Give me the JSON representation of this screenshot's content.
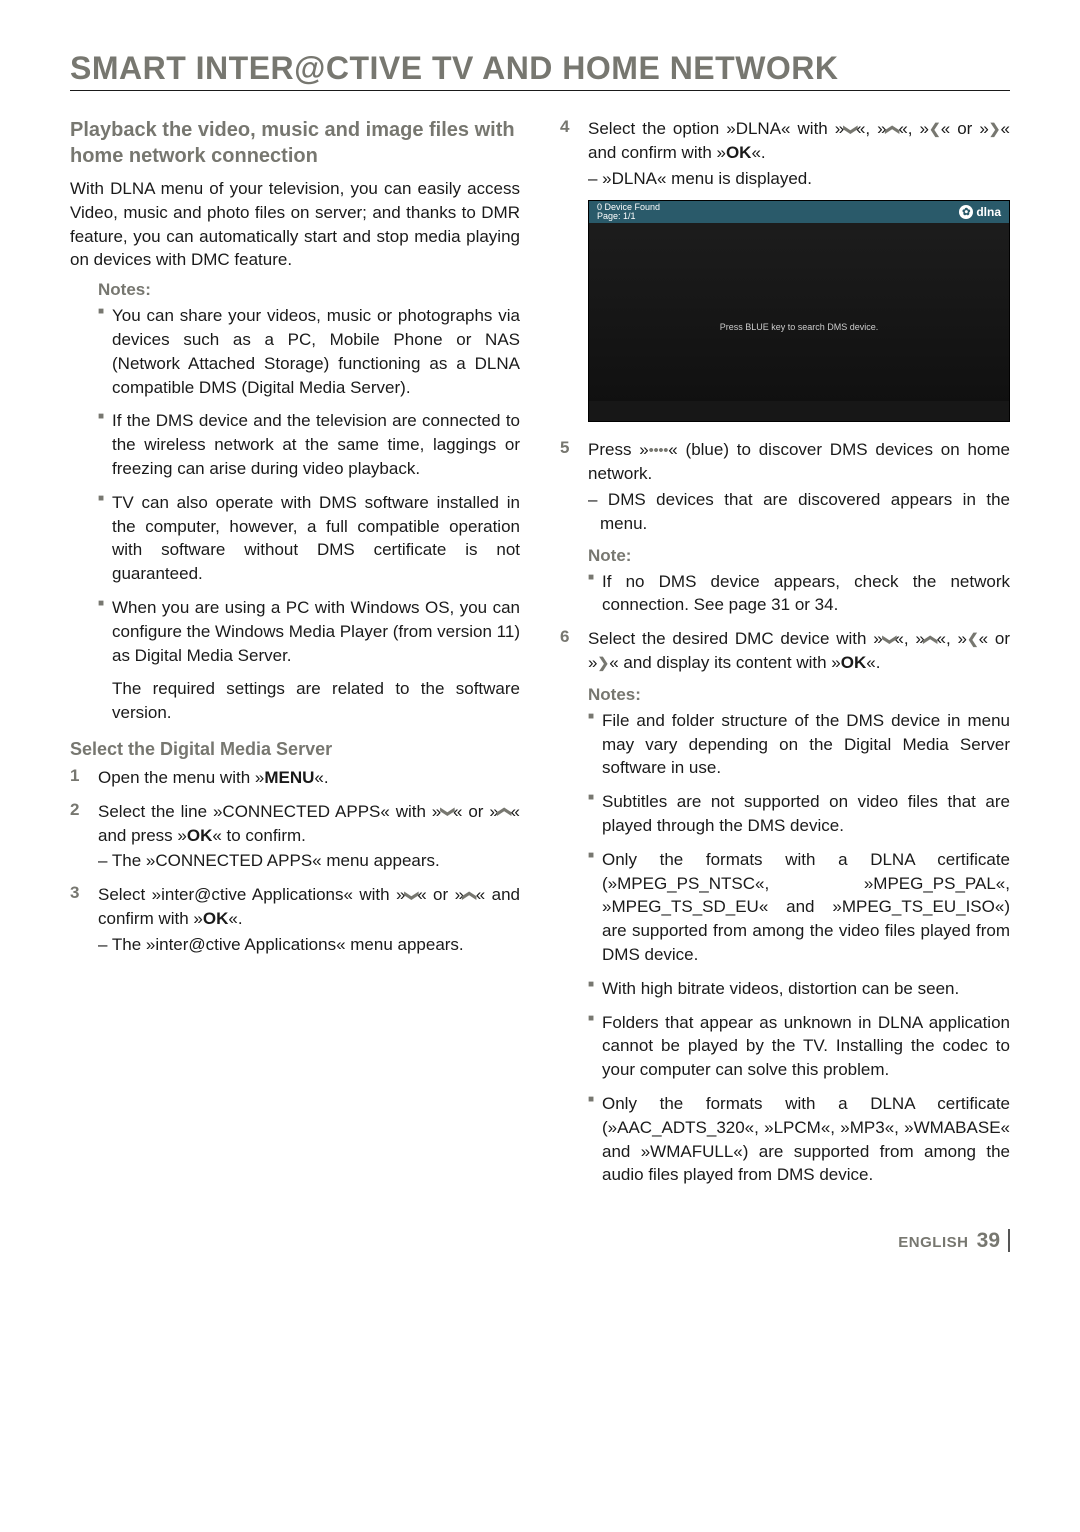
{
  "title": "SMART INTER@CTIVE TV AND HOME NETWORK",
  "left": {
    "heading": "Playback the video, music and image files with home network connection",
    "intro": "With DLNA menu of your television, you can easily access Video, music and photo files on server; and thanks to DMR feature, you can automatically start and stop media playing on devices with DMC feature.",
    "notes_label": "Notes:",
    "notes": [
      "You can share your videos, music or photographs via devices such as a PC, Mobile Phone or NAS (Network Attached Storage) functioning as a DLNA compatible DMS (Digital Media Server).",
      "If the DMS device and the television are connected to the wireless network at the same time, laggings or freezing can arise during video playback.",
      "TV can also operate with DMS software installed in the computer, however, a full compatible operation with software without DMS certificate is not guaranteed.",
      "When you are using a PC with Windows OS, you can configure the Windows Media Player (from version 11) as Digital Media Server.",
      "The required settings are related to the software version."
    ],
    "sub_heading": "Select the Digital Media Server",
    "steps": {
      "s1": {
        "n": "1",
        "pre": "Open the menu with »",
        "key": "MENU",
        "post": "«."
      },
      "s2": {
        "n": "2",
        "text_a": "Select the line »CONNECTED APPS« with »",
        "text_b": "« or »",
        "text_c": "« and press »",
        "key": "OK",
        "text_d": "« to confirm.",
        "sub": "– The »CONNECTED APPS« menu appears."
      },
      "s3": {
        "n": "3",
        "text_a": "Select »inter@ctive Applications« with »",
        "text_b": "« or »",
        "text_c": "« and confirm with »",
        "key": "OK",
        "text_d": "«.",
        "sub": "– The »inter@ctive Applications« menu appears."
      }
    }
  },
  "right": {
    "step4": {
      "n": "4",
      "text_a": "Select the option »DLNA« with »",
      "text_b": "«, »",
      "text_c": "«, »",
      "text_d": "« or »",
      "text_e": "« and confirm with »",
      "key": "OK",
      "text_f": "«.",
      "sub": "– »DLNA« menu is displayed."
    },
    "screenshot": {
      "device_found": "0   Device Found",
      "page": "Page:        1/1",
      "hint": "Press BLUE key to search DMS device.",
      "logo": "dlna"
    },
    "step5": {
      "n": "5",
      "text_a": "Press »",
      "dots": "••••",
      "text_b": "« (blue) to discover DMS devices on home network.",
      "sub": "– DMS devices that are discovered appears in the menu."
    },
    "note_label": "Note:",
    "note_items": [
      "If no DMS device appears, check the network connection. See page 31 or 34."
    ],
    "step6": {
      "n": "6",
      "text_a": "Select the desired DMC device with »",
      "text_b": "«, »",
      "text_c": "«, »",
      "text_d": "« or »",
      "text_e": "« and display its content with »",
      "key": "OK",
      "text_f": "«."
    },
    "notes_label": "Notes:",
    "notes": [
      "File and folder structure of the DMS device in menu may vary depending on the Digital Media Server software in use.",
      "Subtitles are not supported on video files that are played through the DMS device.",
      "Only the formats with a DLNA certificate (»MPEG_PS_NTSC«, »MPEG_PS_PAL«, »MPEG_TS_SD_EU« and »MPEG_TS_EU_ISO«) are supported from among the video files played from DMS device.",
      "With high bitrate videos, distortion can be seen.",
      "Folders that appear as unknown in DLNA application cannot be played by the TV. Installing the codec to your computer can solve this problem.",
      "Only the formats with a DLNA certificate (»AAC_ADTS_320«, »LPCM«, »MP3«, »WMABASE« and »WMAFULL«) are supported from among the audio files played from DMS device."
    ]
  },
  "footer": {
    "lang": "ENGLISH",
    "page": "39"
  },
  "glyphs": {
    "down": "❮",
    "up": "❯",
    "left": "❮",
    "right": "❯"
  }
}
